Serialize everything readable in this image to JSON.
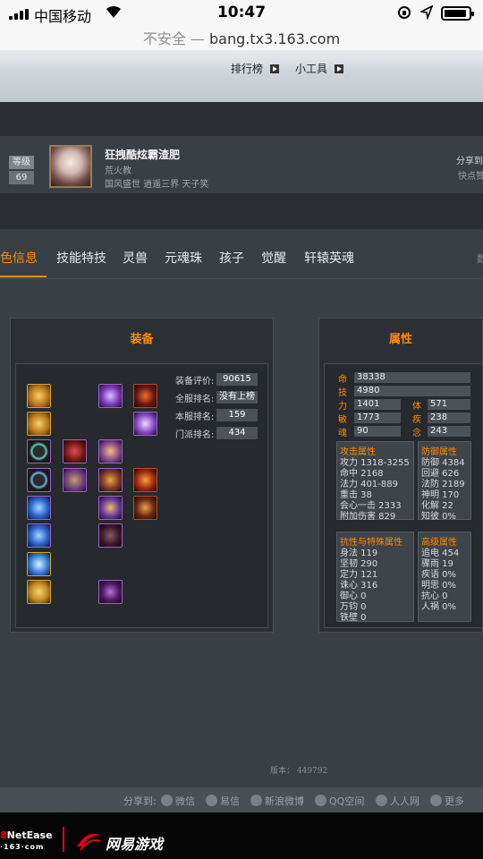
{
  "status_bar": {
    "carrier": "中国移动",
    "time": "10:47"
  },
  "url_bar": {
    "insecure": "不安全",
    "separator": "—",
    "domain": "bang.tx3.163.com"
  },
  "top_links": [
    "排行榜",
    "小工具"
  ],
  "profile": {
    "level_label": "等级",
    "level": "69",
    "name": "狂拽酷炫霸渣肥",
    "sect": "荒火教",
    "server": "国风盛世 逍遥三界 天子笑",
    "share": "分享到",
    "quick": "快点赞"
  },
  "tabs": [
    "色信息",
    "技能特技",
    "灵兽",
    "元魂珠",
    "孩子",
    "觉醒",
    "轩辕英魂"
  ],
  "tab_extra": "数",
  "equip_panel": {
    "title": "装备",
    "eval_rows": [
      {
        "label": "装备评价:",
        "value": "90615"
      },
      {
        "label": "全服排名:",
        "value": "没有上榜"
      },
      {
        "label": "本服排名:",
        "value": "159"
      },
      {
        "label": "门派排名:",
        "value": "434"
      }
    ]
  },
  "attr_panel": {
    "title": "属性",
    "main_stats": [
      {
        "key": "命",
        "value": "38338"
      },
      {
        "key": "技",
        "value": "4980"
      }
    ],
    "pair_stats": [
      {
        "k1": "力",
        "v1": "1401",
        "k2": "体",
        "v2": "571"
      },
      {
        "k1": "敏",
        "v1": "1773",
        "k2": "疾",
        "v2": "238"
      },
      {
        "k1": "魂",
        "v1": "90",
        "k2": "念",
        "v2": "243"
      }
    ],
    "attack": {
      "title": "攻击属性",
      "lines": [
        "攻力 1318-3255",
        "命中 2168",
        "法力 401-889",
        "重击 38",
        "会心一击 2333",
        "附加伤害 829"
      ]
    },
    "defense": {
      "title": "防御属性",
      "lines": [
        "防御 4384",
        "回避 626",
        "法防 2189",
        "神明 170",
        "化解 22",
        "知彼 0%"
      ]
    },
    "resist": {
      "title": "抗性与特殊属性",
      "lines": [
        "身法 119",
        "坚韧 290",
        "定力 121",
        "诛心 316",
        "御心 0",
        "万钧 0",
        "铁壁 0"
      ]
    },
    "advanced": {
      "title": "高级属性",
      "lines": [
        "追电 454",
        "骤雨 19",
        "疾语 0%",
        "明思 0%",
        "抗心 0",
        "人祸 0%"
      ]
    }
  },
  "version": "版本： 449792",
  "share_bar": {
    "label": "分享到:",
    "items": [
      "微信",
      "易信",
      "新浪微博",
      "QQ空间",
      "人人网",
      "更多"
    ]
  },
  "footer": {
    "brand": "NetEase",
    "sub": "·163·com",
    "slogan": "网易游戏"
  },
  "colors": {
    "accent": "#ff8a00",
    "gold_slot": "#d3a22b",
    "purple_slot": "#a060c8"
  }
}
